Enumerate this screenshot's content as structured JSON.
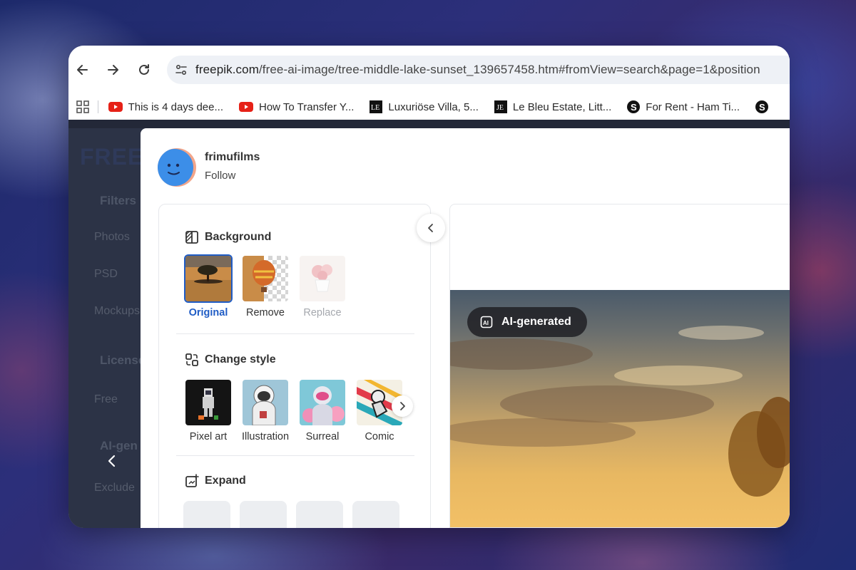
{
  "browser": {
    "url": "freepik.com/free-ai-image/tree-middle-lake-sunset_139657458.htm#fromView=search&page=1&position",
    "url_domain": "freepik.com",
    "url_path": "/free-ai-image/tree-middle-lake-sunset_139657458.htm#fromView=search&page=1&position",
    "bookmarks": [
      {
        "label": "This is 4 days dee...",
        "icon": "youtube-icon"
      },
      {
        "label": "How To Transfer Y...",
        "icon": "youtube-icon"
      },
      {
        "label": "Luxuriöse Villa, 5...",
        "icon": "le-logo-icon"
      },
      {
        "label": "Le Bleu Estate, Litt...",
        "icon": "le-logo-icon"
      },
      {
        "label": "For Rent - Ham Ti...",
        "icon": "dollar-logo-icon"
      }
    ]
  },
  "sidebar_dimmed": {
    "logo": "FREE",
    "filters": "Filters",
    "photos": "Photos",
    "psd": "PSD",
    "mockups": "Mockups",
    "license": "License",
    "free": "Free",
    "ai_generated": "AI-gen",
    "exclude": "Exclude"
  },
  "author": {
    "name": "frimufilms",
    "follow": "Follow"
  },
  "panel": {
    "background": {
      "title": "Background",
      "options": [
        {
          "label": "Original",
          "state": "selected"
        },
        {
          "label": "Remove",
          "state": "normal"
        },
        {
          "label": "Replace",
          "state": "disabled"
        }
      ]
    },
    "change_style": {
      "title": "Change style",
      "options": [
        {
          "label": "Pixel art"
        },
        {
          "label": "Illustration"
        },
        {
          "label": "Surreal"
        },
        {
          "label": "Comic"
        }
      ]
    },
    "expand": {
      "title": "Expand"
    }
  },
  "preview": {
    "badge": "AI-generated"
  },
  "colors": {
    "accent": "#1f5cc5",
    "disabled_text": "#a5a8ae",
    "page_dark": "#1c2333"
  }
}
